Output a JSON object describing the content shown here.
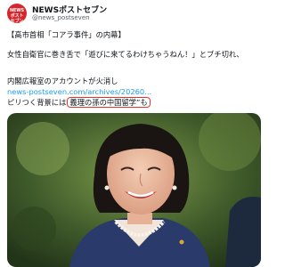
{
  "account": {
    "avatar_text": "NEWS\nポスト\nセブン",
    "display_name": "NEWSポストセブン",
    "handle": "@news_postseven"
  },
  "tweet": {
    "line1": "【高市首相「コアラ事件」の内幕】",
    "line2": "女性自衛官に巻き舌で「遊びに来てるわけちゃうねん！」とブチ切れ、",
    "line3": "内閣広報室のアカウントが火消し",
    "link": "news-postseven.com/archives/20260...",
    "line5_prefix": "ピリつく背景には",
    "line5_circled": "義理の孫の中国留学”も"
  },
  "media": {
    "icon": "photo-of-woman-smiling"
  },
  "colors": {
    "accent": "#1d9bf0",
    "brand": "#d8242b",
    "highlight": "#e8322c"
  }
}
